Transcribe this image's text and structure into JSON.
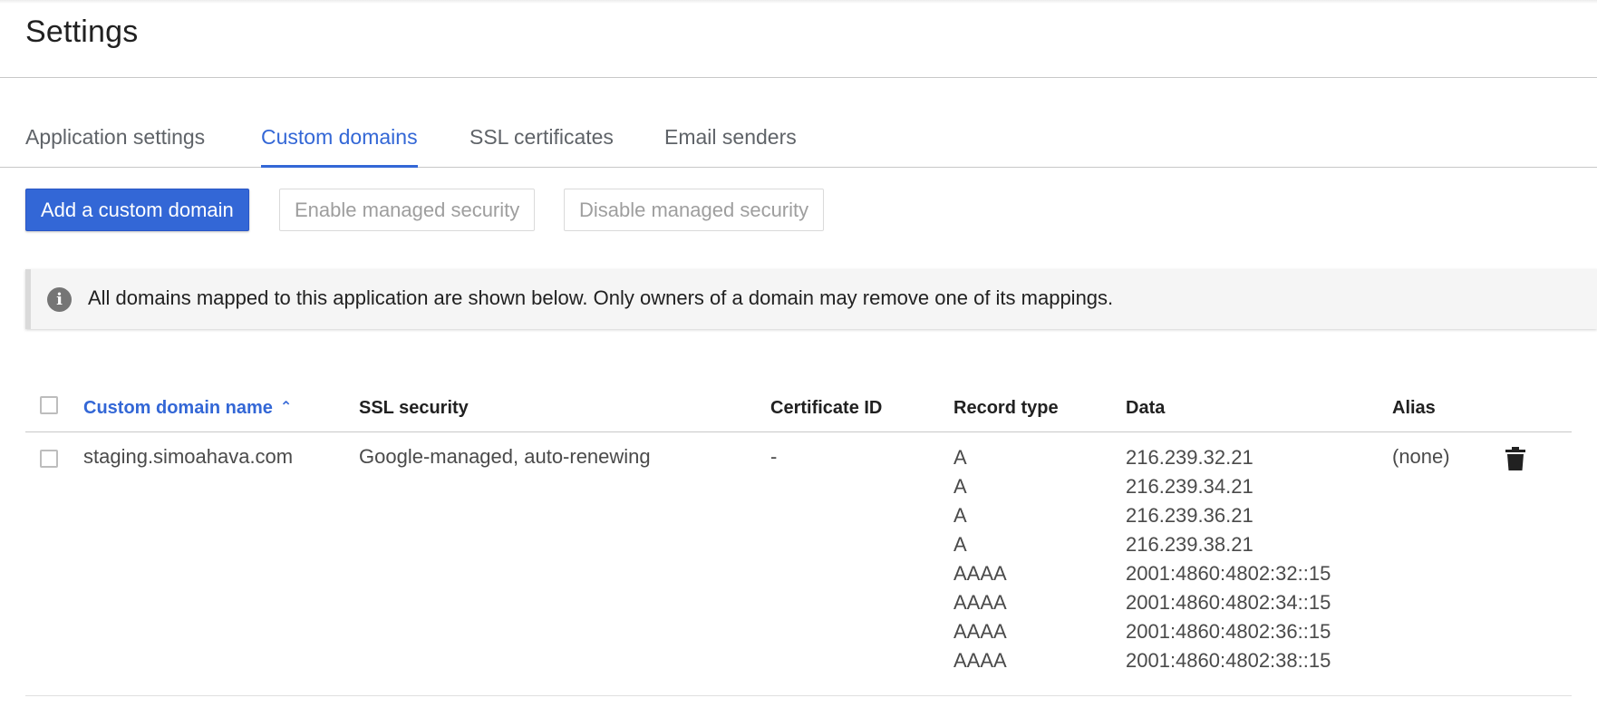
{
  "page": {
    "title": "Settings"
  },
  "tabs": [
    {
      "label": "Application settings",
      "active": false
    },
    {
      "label": "Custom domains",
      "active": true
    },
    {
      "label": "SSL certificates",
      "active": false
    },
    {
      "label": "Email senders",
      "active": false
    }
  ],
  "toolbar": {
    "add_label": "Add a custom domain",
    "enable_label": "Enable managed security",
    "disable_label": "Disable managed security"
  },
  "info": {
    "icon": "info-icon",
    "text": "All domains mapped to this application are shown below. Only owners of a domain may remove one of its mappings."
  },
  "table": {
    "columns": {
      "domain": "Custom domain name",
      "ssl": "SSL security",
      "cert": "Certificate ID",
      "record_type": "Record type",
      "data": "Data",
      "alias": "Alias"
    },
    "sort": {
      "column": "domain",
      "direction": "ascending"
    },
    "rows": [
      {
        "domain": "staging.simoahava.com",
        "ssl": "Google-managed, auto-renewing",
        "cert": "-",
        "records": [
          {
            "type": "A",
            "data": "216.239.32.21"
          },
          {
            "type": "A",
            "data": "216.239.34.21"
          },
          {
            "type": "A",
            "data": "216.239.36.21"
          },
          {
            "type": "A",
            "data": "216.239.38.21"
          },
          {
            "type": "AAAA",
            "data": "2001:4860:4802:32::15"
          },
          {
            "type": "AAAA",
            "data": "2001:4860:4802:34::15"
          },
          {
            "type": "AAAA",
            "data": "2001:4860:4802:36::15"
          },
          {
            "type": "AAAA",
            "data": "2001:4860:4802:38::15"
          }
        ],
        "alias": "(none)"
      }
    ]
  },
  "colors": {
    "accent": "#3367d6",
    "disabled_text": "#9e9e9e",
    "divider": "#c8c8c8"
  }
}
